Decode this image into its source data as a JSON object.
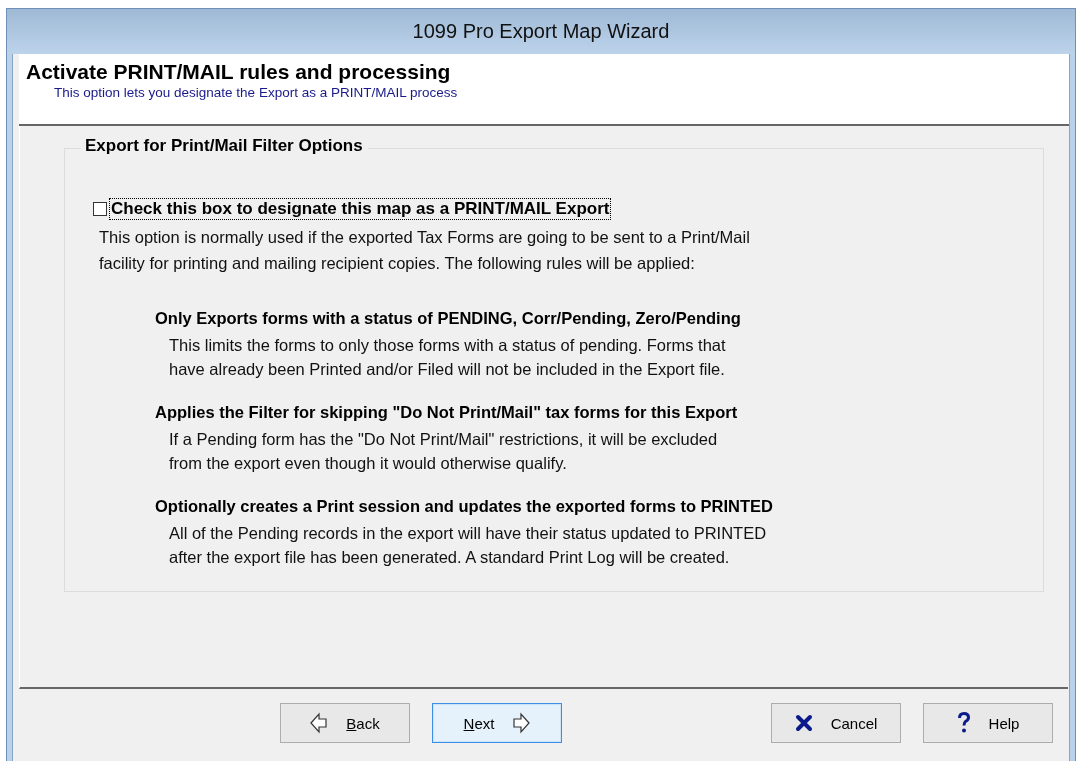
{
  "window": {
    "title": "1099 Pro Export Map Wizard"
  },
  "header": {
    "title": "Activate PRINT/MAIL rules and processing",
    "subtitle": "This option lets you designate the Export as a PRINT/MAIL process"
  },
  "group": {
    "title": "Export for Print/Mail Filter Options",
    "checkbox": {
      "label": "Check this box to designate this map as a PRINT/MAIL Export",
      "checked": false,
      "focused": true
    },
    "description": [
      "This option is normally used if the exported Tax Forms are going to be sent to a Print/Mail",
      "facility for printing and mailing recipient copies.  The following rules will be applied:"
    ],
    "rules": [
      {
        "title": "Only Exports forms with a status of PENDING, Corr/Pending, Zero/Pending",
        "lines": [
          "This limits the forms to only those forms with a status of pending.  Forms that",
          "have already been Printed and/or Filed will not be included in the Export file."
        ]
      },
      {
        "title": "Applies the Filter for skipping \"Do Not Print/Mail\" tax forms for this Export",
        "lines": [
          "If a Pending form has the \"Do Not Print/Mail\" restrictions, it will be excluded",
          "from the export even though it would otherwise qualify."
        ]
      },
      {
        "title": "Optionally creates a Print session and updates the exported forms to PRINTED",
        "lines": [
          "All of the Pending records in the export will have their status updated to PRINTED",
          "after the export file has been generated.  A standard Print Log will be created."
        ]
      }
    ]
  },
  "buttons": [
    {
      "kind": "back",
      "label": "Back",
      "selected": false
    },
    {
      "kind": "next",
      "label": "Next",
      "selected": true
    },
    {
      "kind": "cancel",
      "label": "Cancel",
      "selected": false
    },
    {
      "kind": "help",
      "label": "Help",
      "selected": false
    }
  ]
}
